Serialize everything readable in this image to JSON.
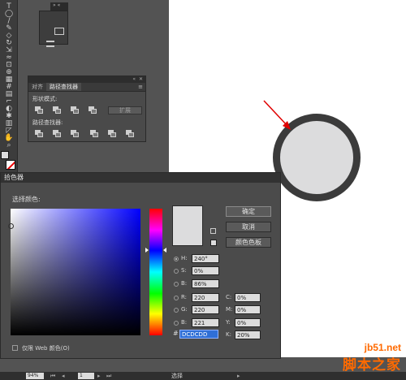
{
  "toolbox": {
    "tools": [
      {
        "icon": "type-tool-icon",
        "glyph": "T"
      },
      {
        "icon": "ellipse-tool-icon",
        "glyph": "◯"
      },
      {
        "icon": "brush-tool-icon",
        "glyph": "/"
      },
      {
        "icon": "pencil-tool-icon",
        "glyph": "✎"
      },
      {
        "icon": "eraser-tool-icon",
        "glyph": "◇"
      },
      {
        "icon": "rotate-tool-icon",
        "glyph": "↻"
      },
      {
        "icon": "scale-tool-icon",
        "glyph": "⇲"
      },
      {
        "icon": "warp-tool-icon",
        "glyph": "≈"
      },
      {
        "icon": "free-transform-tool-icon",
        "glyph": "⊡"
      },
      {
        "icon": "shape-builder-tool-icon",
        "glyph": "⊕"
      },
      {
        "icon": "perspective-grid-tool-icon",
        "glyph": "▦"
      },
      {
        "icon": "mesh-tool-icon",
        "glyph": "#"
      },
      {
        "icon": "gradient-tool-icon",
        "glyph": "▤"
      },
      {
        "icon": "eyedropper-tool-icon",
        "glyph": "⌐"
      },
      {
        "icon": "blend-tool-icon",
        "glyph": "◐"
      },
      {
        "icon": "symbol-sprayer-tool-icon",
        "glyph": "✱"
      },
      {
        "icon": "column-graph-tool-icon",
        "glyph": "▥"
      },
      {
        "icon": "slice-tool-icon",
        "glyph": "◸"
      },
      {
        "icon": "hand-tool-icon",
        "glyph": "✋"
      },
      {
        "icon": "zoom-tool-icon",
        "glyph": "⌕"
      }
    ],
    "fill_color": "#dcdcdd",
    "stroke_color": "#ffffff"
  },
  "mini_panel": {
    "tabs_label": "»  «"
  },
  "pathfinder": {
    "collapse_control": "«",
    "close_control": "✕",
    "tabs": [
      {
        "label": "对齐"
      },
      {
        "label": "路径查找器"
      }
    ],
    "menu_icon": "≡",
    "shape_modes_label": "形状模式:",
    "pathfinders_label": "路径查找器:",
    "expand_label": "扩展"
  },
  "color_picker": {
    "title": "拾色器",
    "subtitle": "选择颜色:",
    "buttons": {
      "ok": "确定",
      "cancel": "取消",
      "swatches": "颜色色板"
    },
    "hsb": [
      {
        "label": "H:",
        "value": "240°",
        "selected": true
      },
      {
        "label": "S:",
        "value": "0%",
        "selected": false
      },
      {
        "label": "B:",
        "value": "86%",
        "selected": false
      }
    ],
    "rgb": [
      {
        "label": "R:",
        "value": "220"
      },
      {
        "label": "G:",
        "value": "220"
      },
      {
        "label": "B:",
        "value": "221"
      }
    ],
    "cmyk": [
      {
        "label": "C:",
        "value": "0%"
      },
      {
        "label": "M:",
        "value": "0%"
      },
      {
        "label": "Y:",
        "value": "0%"
      },
      {
        "label": "K:",
        "value": "20%"
      }
    ],
    "hex_prefix": "#",
    "hex": "DCDCDD",
    "web_only_label": "仅限 Web 颜色(O)",
    "current_color": "#dcdcdd",
    "field_base_color": "#0000ff"
  },
  "artwork": {
    "circle_fill": "#dcdcdd",
    "circle_stroke": "#3b3b3b",
    "arrow_color": "#e00000"
  },
  "status_bar": {
    "zoom": "94%",
    "page": "1",
    "status_text": "选择",
    "prev_glyph": "◂",
    "next_glyph": "▸",
    "first_glyph": "⏮",
    "last_glyph": "⏭"
  },
  "watermark": {
    "site": "jb51.net",
    "name": "脚本之家"
  }
}
